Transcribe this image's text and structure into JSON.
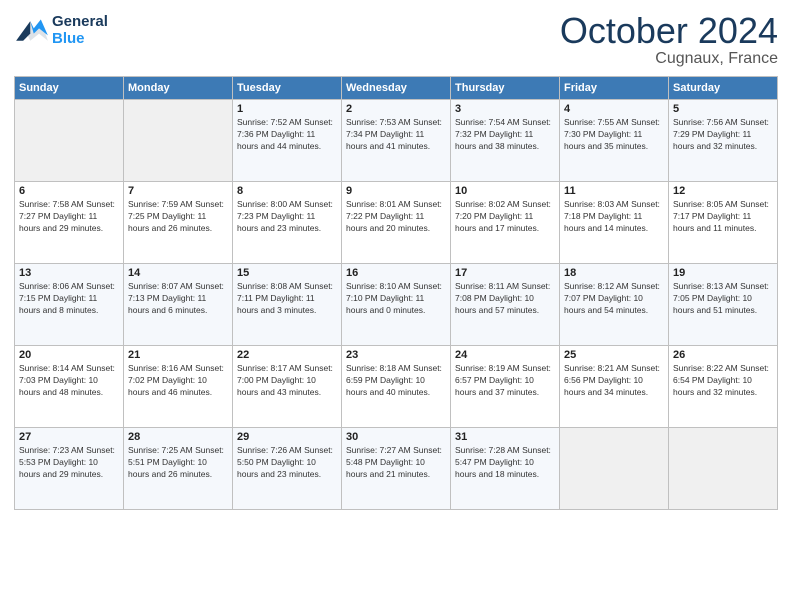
{
  "header": {
    "logo_line1": "General",
    "logo_line2": "Blue",
    "month": "October 2024",
    "location": "Cugnaux, France"
  },
  "days_of_week": [
    "Sunday",
    "Monday",
    "Tuesday",
    "Wednesday",
    "Thursday",
    "Friday",
    "Saturday"
  ],
  "weeks": [
    [
      {
        "num": "",
        "info": ""
      },
      {
        "num": "",
        "info": ""
      },
      {
        "num": "1",
        "info": "Sunrise: 7:52 AM\nSunset: 7:36 PM\nDaylight: 11 hours and 44 minutes."
      },
      {
        "num": "2",
        "info": "Sunrise: 7:53 AM\nSunset: 7:34 PM\nDaylight: 11 hours and 41 minutes."
      },
      {
        "num": "3",
        "info": "Sunrise: 7:54 AM\nSunset: 7:32 PM\nDaylight: 11 hours and 38 minutes."
      },
      {
        "num": "4",
        "info": "Sunrise: 7:55 AM\nSunset: 7:30 PM\nDaylight: 11 hours and 35 minutes."
      },
      {
        "num": "5",
        "info": "Sunrise: 7:56 AM\nSunset: 7:29 PM\nDaylight: 11 hours and 32 minutes."
      }
    ],
    [
      {
        "num": "6",
        "info": "Sunrise: 7:58 AM\nSunset: 7:27 PM\nDaylight: 11 hours and 29 minutes."
      },
      {
        "num": "7",
        "info": "Sunrise: 7:59 AM\nSunset: 7:25 PM\nDaylight: 11 hours and 26 minutes."
      },
      {
        "num": "8",
        "info": "Sunrise: 8:00 AM\nSunset: 7:23 PM\nDaylight: 11 hours and 23 minutes."
      },
      {
        "num": "9",
        "info": "Sunrise: 8:01 AM\nSunset: 7:22 PM\nDaylight: 11 hours and 20 minutes."
      },
      {
        "num": "10",
        "info": "Sunrise: 8:02 AM\nSunset: 7:20 PM\nDaylight: 11 hours and 17 minutes."
      },
      {
        "num": "11",
        "info": "Sunrise: 8:03 AM\nSunset: 7:18 PM\nDaylight: 11 hours and 14 minutes."
      },
      {
        "num": "12",
        "info": "Sunrise: 8:05 AM\nSunset: 7:17 PM\nDaylight: 11 hours and 11 minutes."
      }
    ],
    [
      {
        "num": "13",
        "info": "Sunrise: 8:06 AM\nSunset: 7:15 PM\nDaylight: 11 hours and 8 minutes."
      },
      {
        "num": "14",
        "info": "Sunrise: 8:07 AM\nSunset: 7:13 PM\nDaylight: 11 hours and 6 minutes."
      },
      {
        "num": "15",
        "info": "Sunrise: 8:08 AM\nSunset: 7:11 PM\nDaylight: 11 hours and 3 minutes."
      },
      {
        "num": "16",
        "info": "Sunrise: 8:10 AM\nSunset: 7:10 PM\nDaylight: 11 hours and 0 minutes."
      },
      {
        "num": "17",
        "info": "Sunrise: 8:11 AM\nSunset: 7:08 PM\nDaylight: 10 hours and 57 minutes."
      },
      {
        "num": "18",
        "info": "Sunrise: 8:12 AM\nSunset: 7:07 PM\nDaylight: 10 hours and 54 minutes."
      },
      {
        "num": "19",
        "info": "Sunrise: 8:13 AM\nSunset: 7:05 PM\nDaylight: 10 hours and 51 minutes."
      }
    ],
    [
      {
        "num": "20",
        "info": "Sunrise: 8:14 AM\nSunset: 7:03 PM\nDaylight: 10 hours and 48 minutes."
      },
      {
        "num": "21",
        "info": "Sunrise: 8:16 AM\nSunset: 7:02 PM\nDaylight: 10 hours and 46 minutes."
      },
      {
        "num": "22",
        "info": "Sunrise: 8:17 AM\nSunset: 7:00 PM\nDaylight: 10 hours and 43 minutes."
      },
      {
        "num": "23",
        "info": "Sunrise: 8:18 AM\nSunset: 6:59 PM\nDaylight: 10 hours and 40 minutes."
      },
      {
        "num": "24",
        "info": "Sunrise: 8:19 AM\nSunset: 6:57 PM\nDaylight: 10 hours and 37 minutes."
      },
      {
        "num": "25",
        "info": "Sunrise: 8:21 AM\nSunset: 6:56 PM\nDaylight: 10 hours and 34 minutes."
      },
      {
        "num": "26",
        "info": "Sunrise: 8:22 AM\nSunset: 6:54 PM\nDaylight: 10 hours and 32 minutes."
      }
    ],
    [
      {
        "num": "27",
        "info": "Sunrise: 7:23 AM\nSunset: 5:53 PM\nDaylight: 10 hours and 29 minutes."
      },
      {
        "num": "28",
        "info": "Sunrise: 7:25 AM\nSunset: 5:51 PM\nDaylight: 10 hours and 26 minutes."
      },
      {
        "num": "29",
        "info": "Sunrise: 7:26 AM\nSunset: 5:50 PM\nDaylight: 10 hours and 23 minutes."
      },
      {
        "num": "30",
        "info": "Sunrise: 7:27 AM\nSunset: 5:48 PM\nDaylight: 10 hours and 21 minutes."
      },
      {
        "num": "31",
        "info": "Sunrise: 7:28 AM\nSunset: 5:47 PM\nDaylight: 10 hours and 18 minutes."
      },
      {
        "num": "",
        "info": ""
      },
      {
        "num": "",
        "info": ""
      }
    ]
  ]
}
